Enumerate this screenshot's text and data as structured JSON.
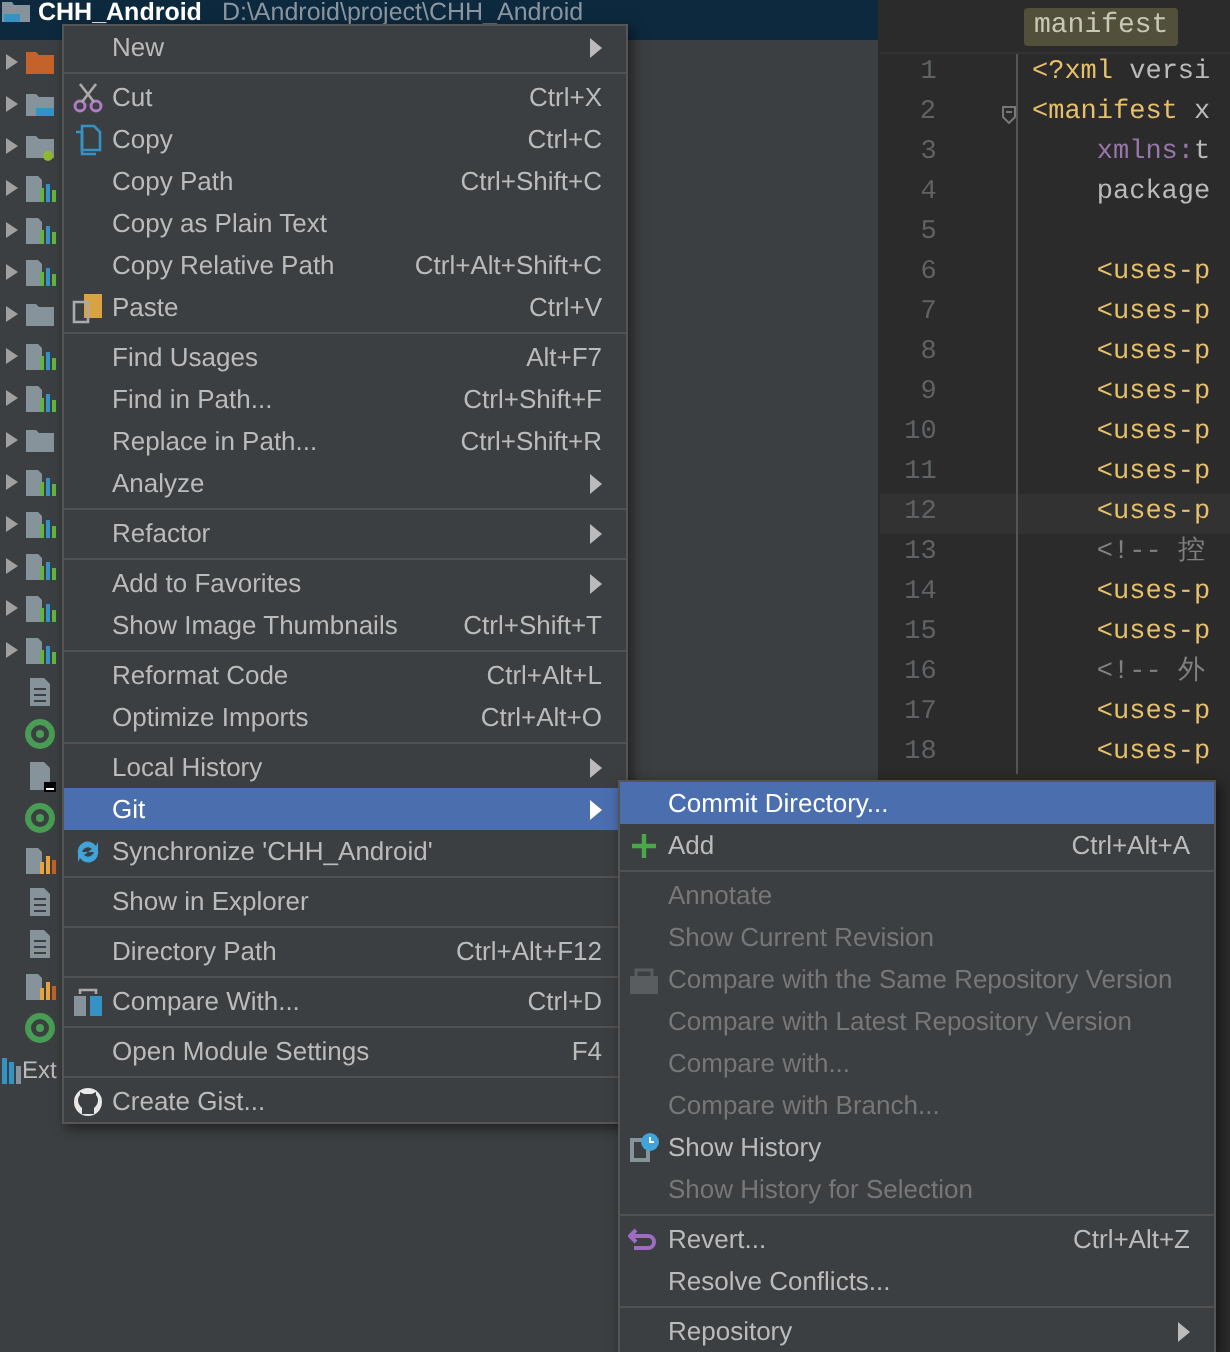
{
  "project_tree": {
    "root": {
      "name": "CHH_Android",
      "path": "D:\\Android\\project\\CHH_Android",
      "selected": true
    },
    "rows": [
      {
        "kind": "folder-res",
        "expandable": true,
        "selected": false
      },
      {
        "kind": "folder-blue",
        "expandable": true,
        "selected": false
      },
      {
        "kind": "folder-green",
        "expandable": true,
        "selected": false
      },
      {
        "kind": "module",
        "expandable": true,
        "selected": false
      },
      {
        "kind": "module",
        "expandable": true,
        "selected": false
      },
      {
        "kind": "module",
        "expandable": true,
        "selected": false
      },
      {
        "kind": "folder",
        "expandable": true,
        "selected": false
      },
      {
        "kind": "module",
        "expandable": true,
        "selected": false
      },
      {
        "kind": "module",
        "expandable": true,
        "selected": false
      },
      {
        "kind": "folder",
        "expandable": true,
        "selected": false
      },
      {
        "kind": "module",
        "expandable": true,
        "selected": false
      },
      {
        "kind": "module",
        "expandable": true,
        "selected": false
      },
      {
        "kind": "module",
        "expandable": true,
        "selected": false
      },
      {
        "kind": "module",
        "expandable": true,
        "selected": false
      },
      {
        "kind": "module",
        "expandable": true,
        "selected": false
      },
      {
        "kind": "file",
        "expandable": false,
        "selected": false
      },
      {
        "kind": "gradle",
        "expandable": false,
        "selected": false
      },
      {
        "kind": "file-dark",
        "expandable": false,
        "selected": false
      },
      {
        "kind": "gradle",
        "expandable": false,
        "selected": false
      },
      {
        "kind": "module-orange",
        "expandable": false,
        "selected": false
      },
      {
        "kind": "file",
        "expandable": false,
        "selected": false
      },
      {
        "kind": "file",
        "expandable": false,
        "selected": false
      },
      {
        "kind": "module-orange",
        "expandable": false,
        "selected": false
      },
      {
        "kind": "gradle",
        "expandable": false,
        "selected": false
      },
      {
        "kind": "library",
        "expandable": false,
        "selected": false,
        "label": "Ext"
      }
    ]
  },
  "editor": {
    "tab": "manifest",
    "lines": [
      {
        "number": "1",
        "current": false,
        "fold": false,
        "segments": [
          {
            "kind": "tag",
            "text": "<?xml"
          },
          {
            "kind": "attr",
            "text": " versi"
          }
        ]
      },
      {
        "number": "2",
        "current": false,
        "fold": true,
        "segments": [
          {
            "kind": "tag",
            "text": "<manifest"
          },
          {
            "kind": "attr",
            "text": " x"
          }
        ]
      },
      {
        "number": "3",
        "current": false,
        "fold": false,
        "segments": [
          {
            "kind": "ns",
            "text": "    xmlns:"
          },
          {
            "kind": "attr",
            "text": "t"
          }
        ]
      },
      {
        "number": "4",
        "current": false,
        "fold": false,
        "segments": [
          {
            "kind": "attr",
            "text": "    package"
          }
        ]
      },
      {
        "number": "5",
        "current": false,
        "fold": false
      },
      {
        "number": "6",
        "current": false,
        "fold": false,
        "segments": [
          {
            "kind": "tag",
            "text": "    <uses-p"
          }
        ]
      },
      {
        "number": "7",
        "current": false,
        "fold": false,
        "segments": [
          {
            "kind": "tag",
            "text": "    <uses-p"
          }
        ]
      },
      {
        "number": "8",
        "current": false,
        "fold": false,
        "segments": [
          {
            "kind": "tag",
            "text": "    <uses-p"
          }
        ]
      },
      {
        "number": "9",
        "current": false,
        "fold": false,
        "segments": [
          {
            "kind": "tag",
            "text": "    <uses-p"
          }
        ]
      },
      {
        "number": "10",
        "current": false,
        "fold": false,
        "segments": [
          {
            "kind": "tag",
            "text": "    <uses-p"
          }
        ]
      },
      {
        "number": "11",
        "current": false,
        "fold": false,
        "segments": [
          {
            "kind": "tag",
            "text": "    <uses-p"
          }
        ]
      },
      {
        "number": "12",
        "current": true,
        "fold": false,
        "segments": [
          {
            "kind": "tag",
            "text": "    <uses-p"
          }
        ]
      },
      {
        "number": "13",
        "current": false,
        "fold": false,
        "segments": [
          {
            "kind": "comment",
            "text": "    <!-- 控"
          }
        ]
      },
      {
        "number": "14",
        "current": false,
        "fold": false,
        "segments": [
          {
            "kind": "tag",
            "text": "    <uses-p"
          }
        ]
      },
      {
        "number": "15",
        "current": false,
        "fold": false,
        "segments": [
          {
            "kind": "tag",
            "text": "    <uses-p"
          }
        ]
      },
      {
        "number": "16",
        "current": false,
        "fold": false,
        "segments": [
          {
            "kind": "comment",
            "text": "    <!-- 外"
          }
        ]
      },
      {
        "number": "17",
        "current": false,
        "fold": false,
        "segments": [
          {
            "kind": "tag",
            "text": "    <uses-p"
          }
        ]
      },
      {
        "number": "18",
        "current": false,
        "fold": false,
        "segments": [
          {
            "kind": "tag",
            "text": "    <uses-p"
          }
        ]
      }
    ]
  },
  "context_menu": {
    "items": [
      {
        "kind": "item",
        "label": "New",
        "submenu": true,
        "selected": false,
        "disabled": false
      },
      {
        "kind": "separator"
      },
      {
        "kind": "item",
        "label": "Cut",
        "shortcut": "Ctrl+X",
        "submenu": false,
        "selected": false,
        "disabled": false
      },
      {
        "kind": "item",
        "label": "Copy",
        "shortcut": "Ctrl+C",
        "submenu": false,
        "selected": false,
        "disabled": false
      },
      {
        "kind": "item",
        "label": "Copy Path",
        "shortcut": "Ctrl+Shift+C",
        "submenu": false,
        "selected": false,
        "disabled": false
      },
      {
        "kind": "item",
        "label": "Copy as Plain Text",
        "submenu": false,
        "selected": false,
        "disabled": false
      },
      {
        "kind": "item",
        "label": "Copy Relative Path",
        "shortcut": "Ctrl+Alt+Shift+C",
        "submenu": false,
        "selected": false,
        "disabled": false
      },
      {
        "kind": "item",
        "label": "Paste",
        "shortcut": "Ctrl+V",
        "submenu": false,
        "selected": false,
        "disabled": false
      },
      {
        "kind": "separator"
      },
      {
        "kind": "item",
        "label": "Find Usages",
        "shortcut": "Alt+F7",
        "submenu": false,
        "selected": false,
        "disabled": false
      },
      {
        "kind": "item",
        "label": "Find in Path...",
        "shortcut": "Ctrl+Shift+F",
        "submenu": false,
        "selected": false,
        "disabled": false
      },
      {
        "kind": "item",
        "label": "Replace in Path...",
        "shortcut": "Ctrl+Shift+R",
        "submenu": false,
        "selected": false,
        "disabled": false
      },
      {
        "kind": "item",
        "label": "Analyze",
        "submenu": true,
        "selected": false,
        "disabled": false
      },
      {
        "kind": "separator"
      },
      {
        "kind": "item",
        "label": "Refactor",
        "submenu": true,
        "selected": false,
        "disabled": false
      },
      {
        "kind": "separator"
      },
      {
        "kind": "item",
        "label": "Add to Favorites",
        "submenu": true,
        "selected": false,
        "disabled": false
      },
      {
        "kind": "item",
        "label": "Show Image Thumbnails",
        "shortcut": "Ctrl+Shift+T",
        "submenu": false,
        "selected": false,
        "disabled": false
      },
      {
        "kind": "separator"
      },
      {
        "kind": "item",
        "label": "Reformat Code",
        "shortcut": "Ctrl+Alt+L",
        "submenu": false,
        "selected": false,
        "disabled": false
      },
      {
        "kind": "item",
        "label": "Optimize Imports",
        "shortcut": "Ctrl+Alt+O",
        "submenu": false,
        "selected": false,
        "disabled": false
      },
      {
        "kind": "separator"
      },
      {
        "kind": "item",
        "label": "Local History",
        "submenu": true,
        "selected": false,
        "disabled": false
      },
      {
        "kind": "item",
        "label": "Git",
        "submenu": true,
        "selected": true,
        "disabled": false
      },
      {
        "kind": "item",
        "label": "Synchronize 'CHH_Android'",
        "submenu": false,
        "selected": false,
        "disabled": false
      },
      {
        "kind": "separator"
      },
      {
        "kind": "item",
        "label": "Show in Explorer",
        "submenu": false,
        "selected": false,
        "disabled": false
      },
      {
        "kind": "separator"
      },
      {
        "kind": "item",
        "label": "Directory Path",
        "shortcut": "Ctrl+Alt+F12",
        "submenu": false,
        "selected": false,
        "disabled": false
      },
      {
        "kind": "separator"
      },
      {
        "kind": "item",
        "label": "Compare With...",
        "shortcut": "Ctrl+D",
        "submenu": false,
        "selected": false,
        "disabled": false
      },
      {
        "kind": "separator"
      },
      {
        "kind": "item",
        "label": "Open Module Settings",
        "shortcut": "F4",
        "submenu": false,
        "selected": false,
        "disabled": false
      },
      {
        "kind": "separator"
      },
      {
        "kind": "item",
        "label": "Create Gist...",
        "submenu": false,
        "selected": false,
        "disabled": false
      }
    ]
  },
  "git_submenu": {
    "items": [
      {
        "kind": "item",
        "label": "Commit Directory...",
        "submenu": false,
        "selected": true,
        "disabled": false
      },
      {
        "kind": "item",
        "label": "Add",
        "shortcut": "Ctrl+Alt+A",
        "submenu": false,
        "selected": false,
        "disabled": false
      },
      {
        "kind": "separator"
      },
      {
        "kind": "item",
        "label": "Annotate",
        "submenu": false,
        "selected": false,
        "disabled": true
      },
      {
        "kind": "item",
        "label": "Show Current Revision",
        "submenu": false,
        "selected": false,
        "disabled": true
      },
      {
        "kind": "item",
        "label": "Compare with the Same Repository Version",
        "submenu": false,
        "selected": false,
        "disabled": true
      },
      {
        "kind": "item",
        "label": "Compare with Latest Repository Version",
        "submenu": false,
        "selected": false,
        "disabled": true
      },
      {
        "kind": "item",
        "label": "Compare with...",
        "submenu": false,
        "selected": false,
        "disabled": true
      },
      {
        "kind": "item",
        "label": "Compare with Branch...",
        "submenu": false,
        "selected": false,
        "disabled": true
      },
      {
        "kind": "item",
        "label": "Show History",
        "submenu": false,
        "selected": false,
        "disabled": false
      },
      {
        "kind": "item",
        "label": "Show History for Selection",
        "submenu": false,
        "selected": false,
        "disabled": true
      },
      {
        "kind": "separator"
      },
      {
        "kind": "item",
        "label": "Revert...",
        "shortcut": "Ctrl+Alt+Z",
        "submenu": false,
        "selected": false,
        "disabled": false
      },
      {
        "kind": "item",
        "label": "Resolve Conflicts...",
        "submenu": false,
        "selected": false,
        "disabled": false
      },
      {
        "kind": "separator"
      },
      {
        "kind": "item",
        "label": "Repository",
        "submenu": true,
        "selected": false,
        "disabled": false
      }
    ]
  }
}
